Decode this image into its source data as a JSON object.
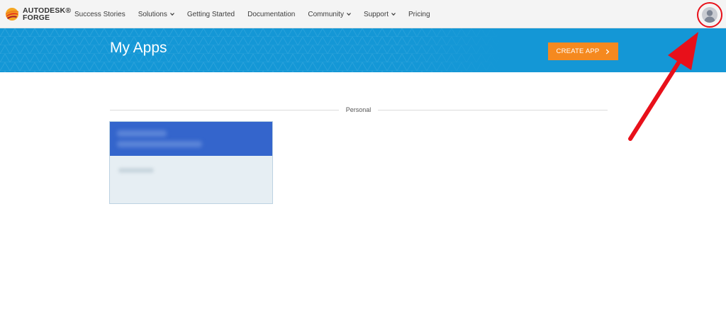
{
  "brand": {
    "name_line1": "AUTODESK®",
    "name_line2": "FORGE",
    "mark_colors": [
      "#f5a623",
      "#e8411c",
      "#a6192e"
    ]
  },
  "nav": {
    "items": [
      {
        "label": "Success Stories",
        "has_dropdown": false
      },
      {
        "label": "Solutions",
        "has_dropdown": true
      },
      {
        "label": "Getting Started",
        "has_dropdown": false
      },
      {
        "label": "Documentation",
        "has_dropdown": false
      },
      {
        "label": "Community",
        "has_dropdown": true
      },
      {
        "label": "Support",
        "has_dropdown": true
      },
      {
        "label": "Pricing",
        "has_dropdown": false
      }
    ],
    "avatar_icon": "user-avatar-icon"
  },
  "banner": {
    "title": "My Apps",
    "create_button_label": "CREATE APP",
    "create_button_icon": "chevron-right-icon",
    "background_color": "#1497d6",
    "button_color": "#f5891f"
  },
  "section": {
    "label": "Personal"
  },
  "annotation": {
    "color": "#e8101a",
    "highlights": "user-avatar"
  }
}
